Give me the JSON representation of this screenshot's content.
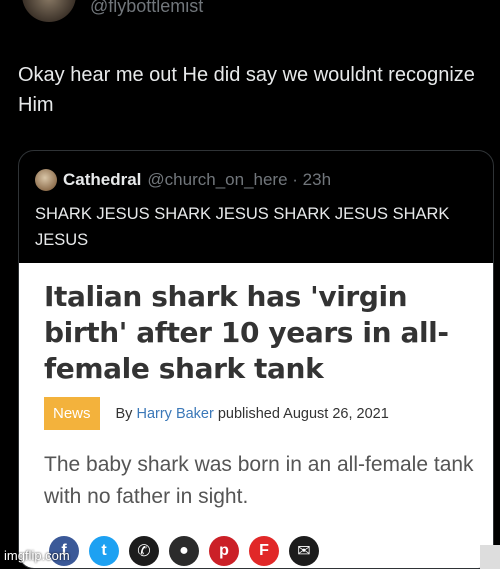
{
  "tweet": {
    "handle": "@flybottlemist",
    "text": "Okay hear me out He did say we wouldnt recognize Him"
  },
  "quote": {
    "name": "Cathedral",
    "handle_time": "@church_on_here · 23h",
    "text": "SHARK JESUS SHARK JESUS SHARK JESUS SHARK JESUS"
  },
  "article": {
    "title": "Italian shark has 'virgin birth' after 10 years in all-female shark tank",
    "category": "News",
    "by": "By",
    "author": "Harry Baker",
    "published": "published August 26, 2021",
    "subtitle": "The baby shark was born in an all-female tank with no father in sight."
  },
  "share_icons": [
    {
      "name": "facebook-icon",
      "glyph": "f",
      "color": "#3b5998"
    },
    {
      "name": "twitter-icon",
      "glyph": "t",
      "color": "#1da1f2"
    },
    {
      "name": "whatsapp-icon",
      "glyph": "✆",
      "color": "#1c1c1c"
    },
    {
      "name": "reddit-icon",
      "glyph": "●",
      "color": "#2b2b2b"
    },
    {
      "name": "pinterest-icon",
      "glyph": "p",
      "color": "#cb2027"
    },
    {
      "name": "flipboard-icon",
      "glyph": "F",
      "color": "#e12828"
    },
    {
      "name": "email-icon",
      "glyph": "✉",
      "color": "#1c1c1c"
    }
  ],
  "watermark": "imgflip.com"
}
